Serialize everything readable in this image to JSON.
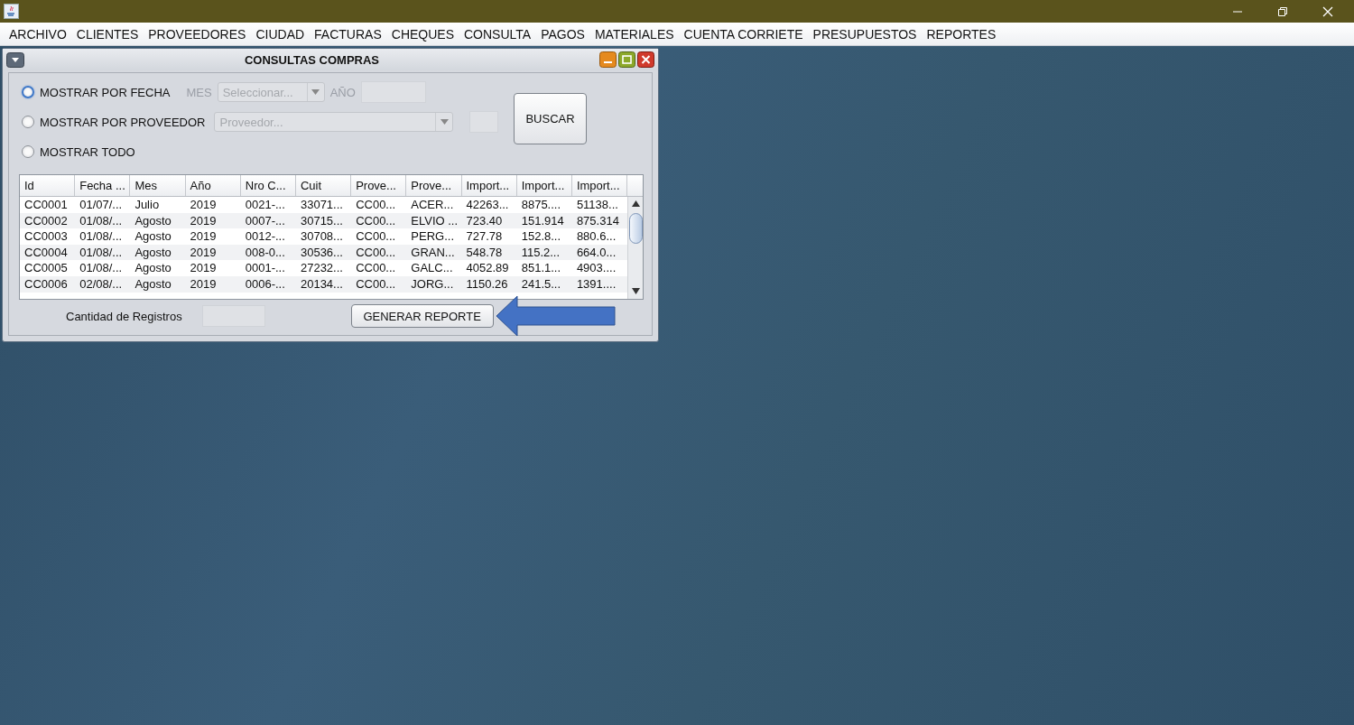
{
  "menu": [
    "ARCHIVO",
    "CLIENTES",
    "PROVEEDORES",
    "CIUDAD",
    "FACTURAS",
    "CHEQUES",
    "CONSULTA",
    "PAGOS",
    "MATERIALES",
    "CUENTA CORRIETE",
    "PRESUPUESTOS",
    "REPORTES"
  ],
  "frame": {
    "title": "CONSULTAS COMPRAS",
    "filters": [
      {
        "label": "MOSTRAR POR FECHA",
        "selected": false,
        "focused": true
      },
      {
        "label": "MOSTRAR POR PROVEEDOR",
        "selected": false,
        "focused": false
      },
      {
        "label": "MOSTRAR TODO",
        "selected": false,
        "focused": false
      }
    ],
    "mes": {
      "label": "MES",
      "placeholder": "Seleccionar...",
      "disabled": true
    },
    "anio": {
      "label": "AÑO",
      "disabled": true
    },
    "proveedor": {
      "placeholder": "Proveedor...",
      "disabled": true
    },
    "search_button": "BUSCAR",
    "table": {
      "columns": [
        "Id",
        "Fecha ...",
        "Mes",
        "Año",
        "Nro C...",
        "Cuit",
        "Prove...",
        "Prove...",
        "Import...",
        "Import...",
        "Import..."
      ],
      "rows": [
        [
          "CC0001",
          "01/07/...",
          "Julio",
          "2019",
          "0021-...",
          "33071...",
          "CC00...",
          "ACER...",
          "42263...",
          "8875....",
          "51138..."
        ],
        [
          "CC0002",
          "01/08/...",
          "Agosto",
          "2019",
          "0007-...",
          "30715...",
          "CC00...",
          "ELVIO ...",
          "723.40",
          "151.914",
          "875.314"
        ],
        [
          "CC0003",
          "01/08/...",
          "Agosto",
          "2019",
          "0012-...",
          "30708...",
          "CC00...",
          "PERG...",
          "727.78",
          "152.8...",
          "880.6..."
        ],
        [
          "CC0004",
          "01/08/...",
          "Agosto",
          "2019",
          "008-0...",
          "30536...",
          "CC00...",
          "GRAN...",
          "548.78",
          "115.2...",
          "664.0..."
        ],
        [
          "CC0005",
          "01/08/...",
          "Agosto",
          "2019",
          "0001-...",
          "27232...",
          "CC00...",
          "GALC...",
          "4052.89",
          "851.1...",
          "4903...."
        ],
        [
          "CC0006",
          "02/08/...",
          "Agosto",
          "2019",
          "0006-...",
          "20134...",
          "CC00...",
          "JORG...",
          "1150.26",
          "241.5...",
          "1391...."
        ]
      ]
    },
    "count_label": "Cantidad de Registros",
    "report_button": "GENERAR REPORTE"
  }
}
